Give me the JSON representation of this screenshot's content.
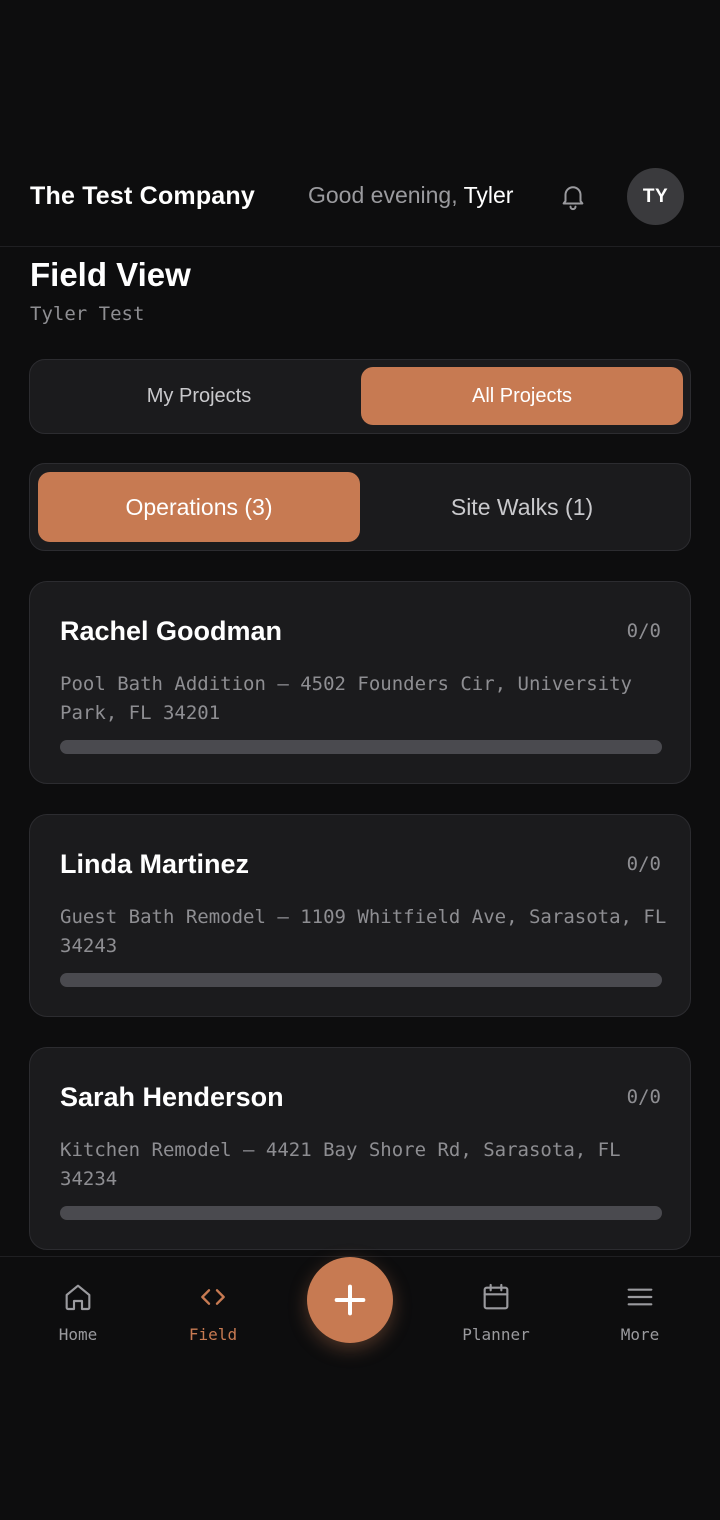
{
  "header": {
    "company_name": "The Test Company",
    "greeting_prefix": "Good evening,",
    "user_first_name": "Tyler",
    "avatar_initials": "TY"
  },
  "page": {
    "title": "Field View",
    "subtitle": "Tyler Test"
  },
  "project_filter": {
    "options": [
      "My Projects",
      "All Projects"
    ],
    "selected": "All Projects"
  },
  "category_tabs": {
    "options": [
      "Operations (3)",
      "Site Walks (1)"
    ],
    "selected": "Operations (3)"
  },
  "projects": [
    {
      "name": "Rachel Goodman",
      "count": "0/0",
      "description": "Pool Bath Addition — 4502 Founders Cir, University Park, FL 34201",
      "progress": 0
    },
    {
      "name": "Linda Martinez",
      "count": "0/0",
      "description": "Guest Bath Remodel — 1109 Whitfield Ave, Sarasota, FL 34243",
      "progress": 0
    },
    {
      "name": "Sarah Henderson",
      "count": "0/0",
      "description": "Kitchen Remodel — 4421 Bay Shore Rd, Sarasota, FL 34234",
      "progress": 0
    }
  ],
  "bottom_nav": {
    "items": [
      {
        "label": "Home",
        "icon": "home-icon"
      },
      {
        "label": "Field",
        "icon": "code-brackets-icon"
      },
      {
        "label": "Planner",
        "icon": "calendar-icon"
      },
      {
        "label": "More",
        "icon": "menu-icon"
      }
    ],
    "active": "Field",
    "fab_icon": "plus-icon"
  },
  "colors": {
    "accent": "#c77a52",
    "background": "#0d0d0e",
    "card": "#1b1b1d",
    "muted_text": "#8e8e92"
  }
}
